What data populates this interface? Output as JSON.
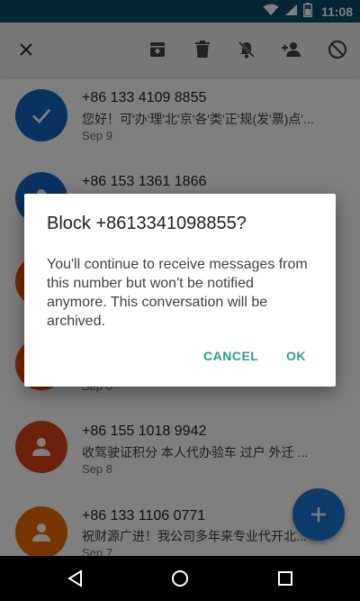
{
  "status_bar": {
    "time": "11:08",
    "icons": [
      "wifi-icon",
      "signal-icon",
      "battery-icon"
    ]
  },
  "toolbar": {
    "buttons": [
      "close-icon",
      "archive-icon",
      "delete-icon",
      "mute-notifications-icon",
      "add-contact-icon",
      "block-icon"
    ]
  },
  "conversations": [
    {
      "name": "+86 133 4109 8855",
      "snippet": "您好！可'办'理'北'京'各'类'正'规(发'票)点'...",
      "date": "Sep 9",
      "selected": true,
      "avatar_color": "#1565c0"
    },
    {
      "name": "+86 153 1361 1866",
      "snippet": "",
      "date": "",
      "selected": false,
      "avatar_color": "#1565c0"
    },
    {
      "name": "",
      "snippet": "",
      "date": "",
      "selected": false,
      "avatar_color": "#e65100"
    },
    {
      "name": "",
      "snippet": "",
      "date": "Sep 8",
      "selected": false,
      "avatar_color": "#e65100"
    },
    {
      "name": "+86 155 1018 9942",
      "snippet": "收驾驶证积分 本人代办验车 过户 外迁 ...",
      "date": "Sep 8",
      "selected": false,
      "avatar_color": "#d84315"
    },
    {
      "name": "+86 133 1106 0771",
      "snippet": "祝财源广进！我公司多年来专业代开北...",
      "date": "Sep 7",
      "selected": false,
      "avatar_color": "#ef6c00"
    }
  ],
  "fab": {
    "icon": "plus-icon",
    "color": "#1976d2"
  },
  "dialog": {
    "title": "Block +8613341098855?",
    "message": "You'll continue to receive messages from this number but won't be notified anymore. This conversation will be archived.",
    "cancel_label": "CANCEL",
    "ok_label": "OK",
    "accent_color": "#2a9d8f"
  },
  "nav_bar": {
    "buttons": [
      "back-icon",
      "home-icon",
      "recents-icon"
    ]
  }
}
